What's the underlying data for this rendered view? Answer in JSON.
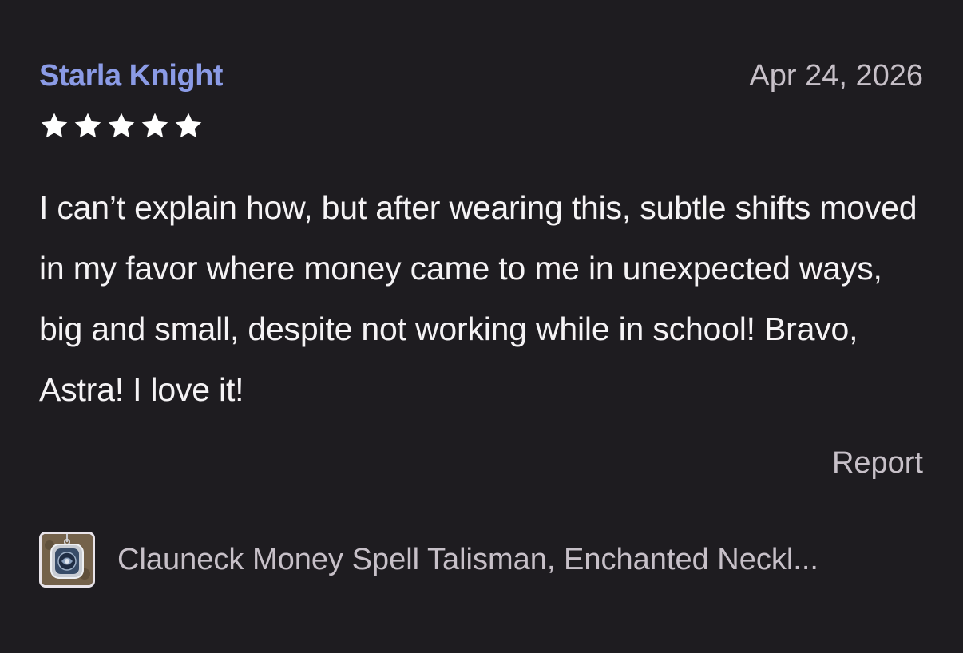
{
  "review": {
    "reviewer_name": "Starla Knight",
    "date": "Apr 24, 2026",
    "rating": 5,
    "rating_max": 5,
    "text": "I can’t explain how, but after wearing this, subtle shifts moved in my favor where money came to me in unexpected ways, big and small, despite not working while in school! Bravo, Astra! I love it!",
    "report_label": "Report"
  },
  "product": {
    "title": "Clauneck Money Spell Talisman, Enchanted Neckl...",
    "thumbnail_icon": "talisman-necklace-thumbnail"
  },
  "colors": {
    "background": "#1e1c20",
    "reviewer_name": "#8b9be6",
    "secondary_text": "#c7c0c8",
    "body_text": "#f5f3f5",
    "star": "#ffffff"
  }
}
